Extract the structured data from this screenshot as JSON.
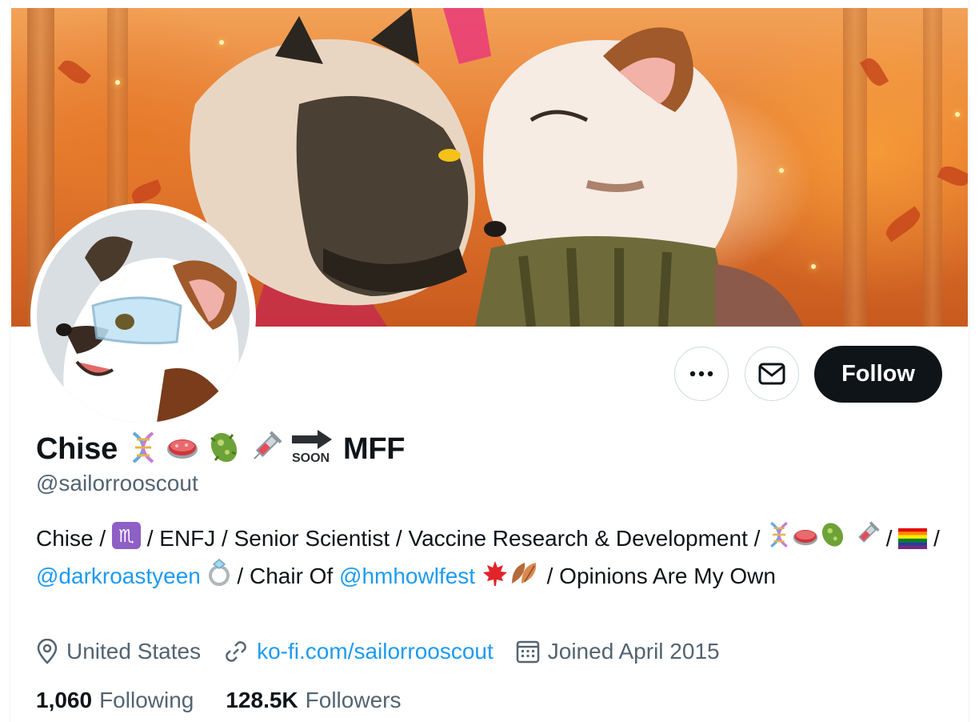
{
  "profile": {
    "name": "Chise",
    "name_suffix": "MFF",
    "soon_label": "SOON",
    "handle": "@sailorrooscout",
    "follow_label": "Follow",
    "more_label": "•••"
  },
  "bio": {
    "part1": "Chise / ",
    "part2": " / ENFJ / Senior Scientist / Vaccine Research & Development / ",
    "part3": " / ",
    "part4": " / ",
    "mention1": "@darkroastyeen",
    "part5": " / Chair Of ",
    "mention2": "@hmhowlfest",
    "part6": " / Opinions Are My Own"
  },
  "meta": {
    "location": "United States",
    "website": "ko-fi.com/sailorrooscout",
    "joined": "Joined April 2015"
  },
  "stats": {
    "following_count": "1,060",
    "following_label": "Following",
    "followers_count": "128.5K",
    "followers_label": "Followers"
  },
  "colors": {
    "accent": "#1d9bf0",
    "follow_bg": "#0f1419",
    "secondary_text": "#536471"
  },
  "icons": {
    "more": "more-dots-icon",
    "message": "envelope-icon",
    "location": "location-pin-icon",
    "link": "link-icon",
    "calendar": "calendar-icon",
    "dna": "dna-icon",
    "petri": "petri-dish-icon",
    "microbe": "microbe-icon",
    "syringe": "syringe-icon",
    "soon_arrow": "soon-arrow-icon",
    "scorpio": "scorpio-icon",
    "rainbow_flag": "rainbow-flag-icon",
    "ring": "ring-icon",
    "maple_leaf": "maple-leaf-icon",
    "fallen_leaf": "fallen-leaf-icon"
  }
}
